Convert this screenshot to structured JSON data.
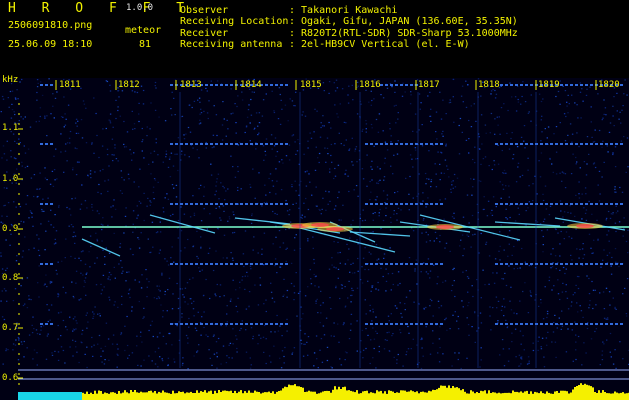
{
  "app": {
    "title": "H R O F F T",
    "version": "1.0.0"
  },
  "file": {
    "name": "2506091810.png",
    "datetime": "25.06.09 18:10"
  },
  "meteor": {
    "label": "meteor",
    "count": "81"
  },
  "info": [
    {
      "label": "Observer",
      "value": ": Takanori Kawachi"
    },
    {
      "label": "Receiving Location",
      "value": ": Ogaki, Gifu, JAPAN (136.60E, 35.35N)"
    },
    {
      "label": "Receiver",
      "value": ": R820T2(RTL-SDR) SDR-Sharp 53.1000MHz"
    },
    {
      "label": "Receiving antenna",
      "value": ": 2el-HB9CV Vertical (el. E-W)"
    }
  ],
  "y_axis": {
    "unit": "kHz",
    "ticks": [
      "1.1",
      "1.0",
      "0.9",
      "0.8",
      "0.7",
      "0.6"
    ]
  },
  "time_axis": {
    "ticks": [
      "1811",
      "1812",
      "1813",
      "1814",
      "1815",
      "1816",
      "1817",
      "1818",
      "1819",
      "1820"
    ]
  },
  "colors": {
    "label": "#f2f200",
    "carrier": "#7cffd0",
    "level_bar": "#f5f000",
    "level_base": "#19d6e8"
  }
}
